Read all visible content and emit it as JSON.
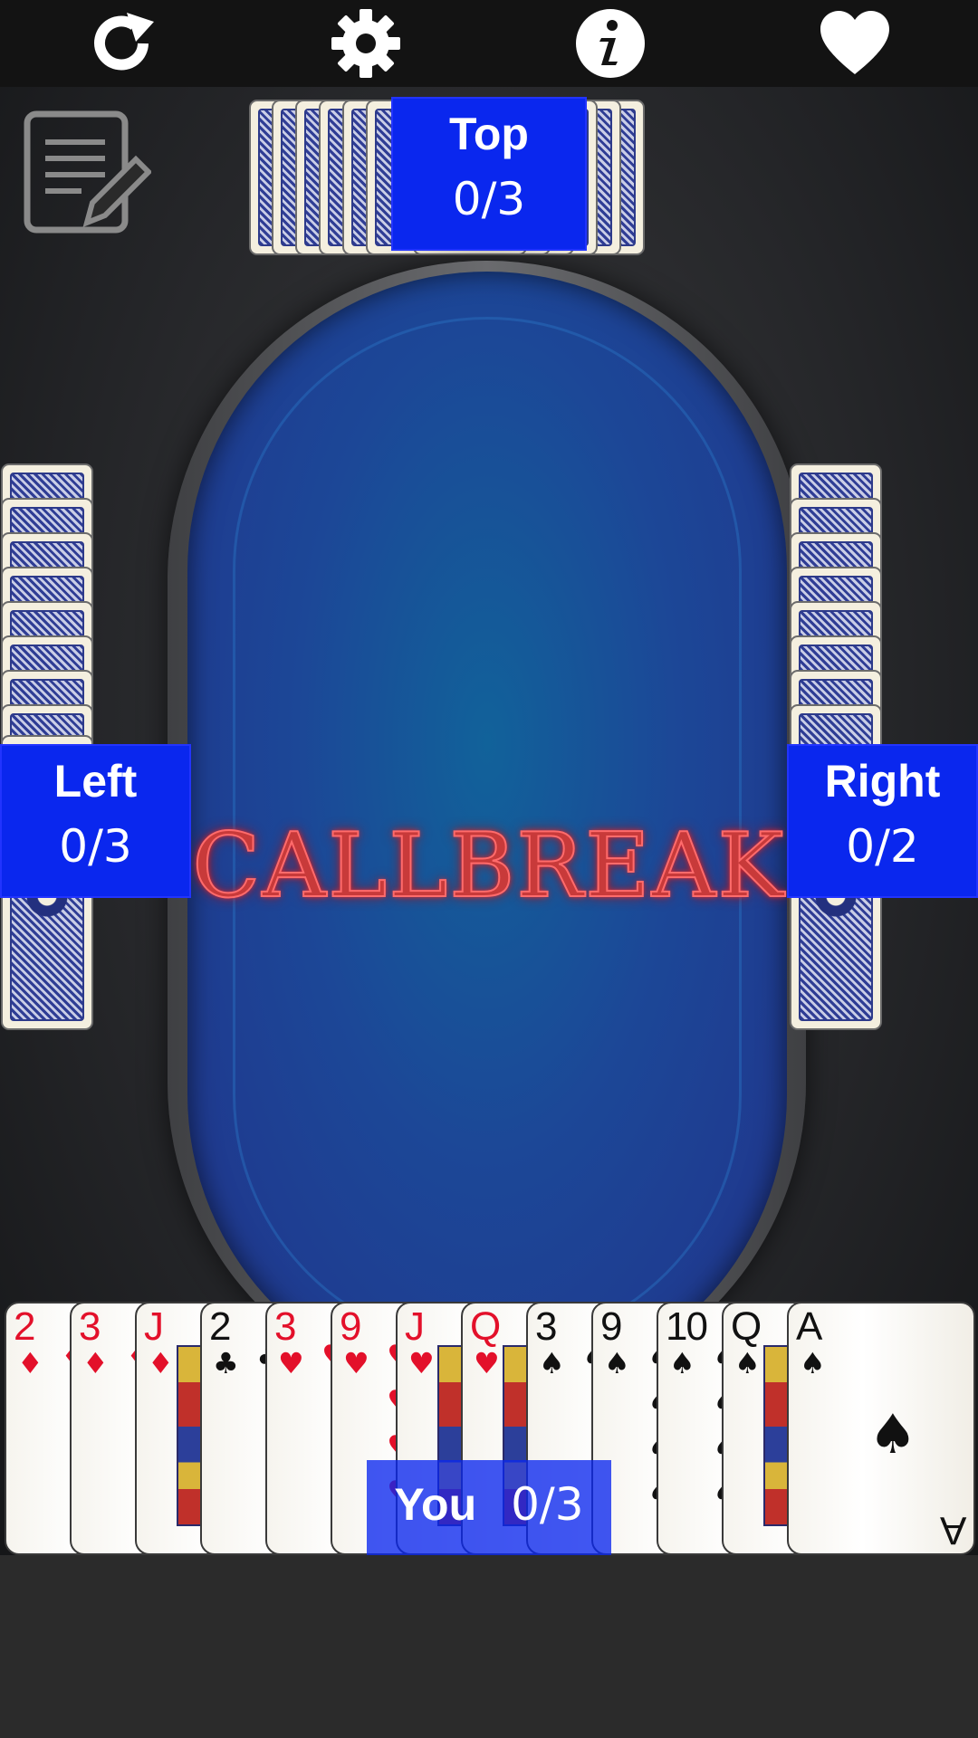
{
  "toolbar": {
    "icons": [
      "refresh-icon",
      "gear-icon",
      "info-icon",
      "heart-icon"
    ]
  },
  "table": {
    "title": "CALLBREAK"
  },
  "players": {
    "top": {
      "name": "Top",
      "score": "0/3"
    },
    "left": {
      "name": "Left",
      "score": "0/3"
    },
    "right": {
      "name": "Right",
      "score": "0/2"
    },
    "you": {
      "name": "You",
      "score": "0/3"
    }
  },
  "hand": [
    {
      "rank": "2",
      "suit": "♦",
      "color": "red"
    },
    {
      "rank": "3",
      "suit": "♦",
      "color": "red"
    },
    {
      "rank": "J",
      "suit": "♦",
      "color": "red"
    },
    {
      "rank": "2",
      "suit": "♣",
      "color": "black"
    },
    {
      "rank": "3",
      "suit": "♥",
      "color": "red"
    },
    {
      "rank": "9",
      "suit": "♥",
      "color": "red"
    },
    {
      "rank": "J",
      "suit": "♥",
      "color": "red"
    },
    {
      "rank": "Q",
      "suit": "♥",
      "color": "red"
    },
    {
      "rank": "3",
      "suit": "♠",
      "color": "black"
    },
    {
      "rank": "9",
      "suit": "♠",
      "color": "black"
    },
    {
      "rank": "10",
      "suit": "♠",
      "color": "black"
    },
    {
      "rank": "Q",
      "suit": "♠",
      "color": "black"
    },
    {
      "rank": "A",
      "suit": "♠",
      "color": "black"
    }
  ],
  "colors": {
    "score_box": "#0a27ee",
    "title": "#c83a3a",
    "felt": "#1c4797"
  }
}
